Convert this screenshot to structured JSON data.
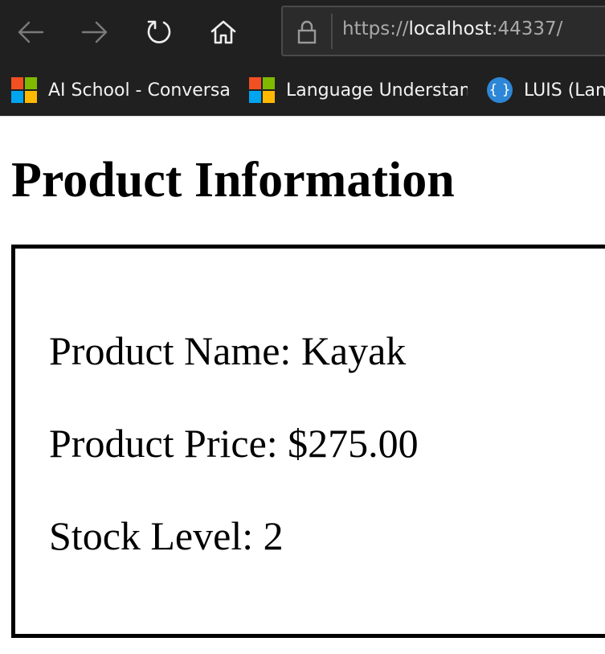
{
  "browser": {
    "nav": {
      "back_icon": "arrow-left-icon",
      "forward_icon": "arrow-right-icon",
      "refresh_icon": "refresh-icon",
      "home_icon": "home-icon"
    },
    "address_bar": {
      "lock_icon": "lock-icon",
      "url_scheme": "https://",
      "url_host": "localhost",
      "url_port_path": ":44337/"
    },
    "bookmarks": [
      {
        "label": "AI School - Conversat",
        "icon": "microsoft-logo-icon"
      },
      {
        "label": "Language Understanc",
        "icon": "microsoft-logo-icon"
      },
      {
        "label": "LUIS (Lang",
        "icon": "braces-icon",
        "glyph": "{ }"
      }
    ],
    "colors": {
      "chrome_bg": "#202020",
      "ms_red": "#f25022",
      "ms_green": "#7fba00",
      "ms_blue": "#00a4ef",
      "ms_yellow": "#ffb900",
      "luis_blue": "#2e86d6"
    }
  },
  "page": {
    "title": "Product Information",
    "product": {
      "name_line": "Product Name: Kayak",
      "price_line": "Product Price: $275.00",
      "stock_line": "Stock Level: 2"
    }
  }
}
